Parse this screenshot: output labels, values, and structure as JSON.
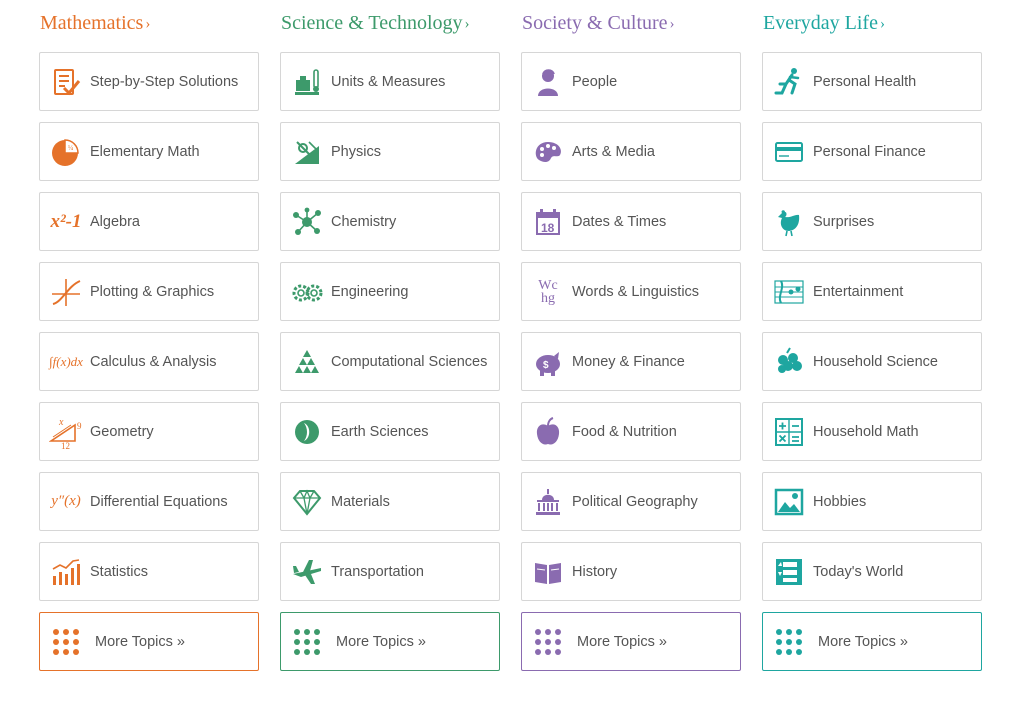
{
  "columns": [
    {
      "title": "Mathematics",
      "color": "#e5722a",
      "chevron": "›",
      "items": [
        {
          "label": "Step-by-Step Solutions",
          "icon": "clipboard-check-icon"
        },
        {
          "label": "Elementary Math",
          "icon": "pie-fraction-icon"
        },
        {
          "label": "Algebra",
          "icon": "algebra-x2-icon"
        },
        {
          "label": "Plotting & Graphics",
          "icon": "graph-curve-icon"
        },
        {
          "label": "Calculus & Analysis",
          "icon": "integral-icon"
        },
        {
          "label": "Geometry",
          "icon": "triangle-icon"
        },
        {
          "label": "Differential Equations",
          "icon": "derivative-icon"
        },
        {
          "label": "Statistics",
          "icon": "bar-chart-icon"
        }
      ],
      "more": "More Topics »"
    },
    {
      "title": "Science & Technology",
      "color": "#3d9a6b",
      "chevron": "›",
      "items": [
        {
          "label": "Units & Measures",
          "icon": "scale-thermometer-icon"
        },
        {
          "label": "Physics",
          "icon": "physics-ramp-icon"
        },
        {
          "label": "Chemistry",
          "icon": "molecule-icon"
        },
        {
          "label": "Engineering",
          "icon": "gears-icon"
        },
        {
          "label": "Computational Sciences",
          "icon": "triangle-pattern-icon"
        },
        {
          "label": "Earth Sciences",
          "icon": "earth-leaf-icon"
        },
        {
          "label": "Materials",
          "icon": "diamond-icon"
        },
        {
          "label": "Transportation",
          "icon": "airplane-icon"
        }
      ],
      "more": "More Topics »"
    },
    {
      "title": "Society & Culture",
      "color": "#8a6bb0",
      "chevron": "›",
      "items": [
        {
          "label": "People",
          "icon": "portrait-bust-icon"
        },
        {
          "label": "Arts & Media",
          "icon": "palette-icon"
        },
        {
          "label": "Dates & Times",
          "icon": "calendar-icon"
        },
        {
          "label": "Words & Linguistics",
          "icon": "letters-icon"
        },
        {
          "label": "Money & Finance",
          "icon": "piggy-bank-icon"
        },
        {
          "label": "Food & Nutrition",
          "icon": "apple-icon"
        },
        {
          "label": "Political Geography",
          "icon": "capitol-icon"
        },
        {
          "label": "History",
          "icon": "open-book-icon"
        }
      ],
      "more": "More Topics »"
    },
    {
      "title": "Everyday Life",
      "color": "#1ea6a0",
      "chevron": "›",
      "items": [
        {
          "label": "Personal Health",
          "icon": "runner-icon"
        },
        {
          "label": "Personal Finance",
          "icon": "credit-card-icon"
        },
        {
          "label": "Surprises",
          "icon": "chicken-icon"
        },
        {
          "label": "Entertainment",
          "icon": "music-staff-icon"
        },
        {
          "label": "Household Science",
          "icon": "berries-icon"
        },
        {
          "label": "Household Math",
          "icon": "calculator-icon"
        },
        {
          "label": "Hobbies",
          "icon": "picture-frame-icon"
        },
        {
          "label": "Today's World",
          "icon": "stock-board-icon"
        }
      ],
      "more": "More Topics »"
    }
  ],
  "icon_text": {
    "algebra": "x²-1",
    "integral": "∫f(x)dx",
    "derivative": "y″(x)",
    "geo_x": "x",
    "geo_9": "9",
    "geo_12": "12",
    "cal_day": "18",
    "letters": "Wc hg"
  }
}
